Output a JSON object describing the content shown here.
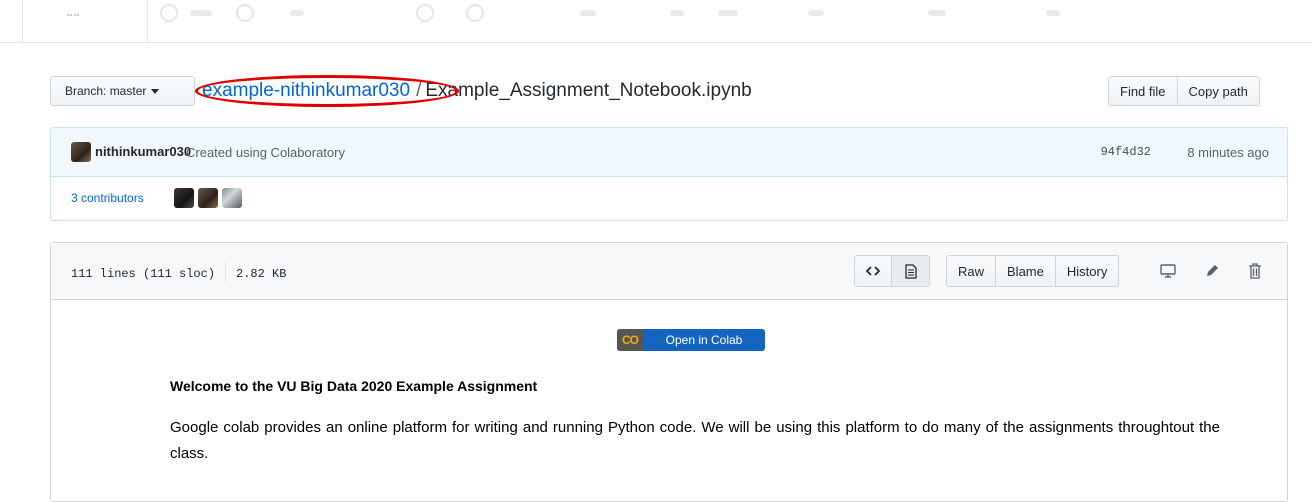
{
  "branch": {
    "label": "Branch: master"
  },
  "breadcrumb": {
    "repo": "example-nithinkumar030",
    "separator": "/",
    "file": "Example_Assignment_Notebook.ipynb"
  },
  "file_actions": {
    "find_file": "Find file",
    "copy_path": "Copy path"
  },
  "commit": {
    "author": "nithinkumar030",
    "message": "Created using Colaboratory",
    "sha": "94f4d32",
    "time": "8 minutes ago",
    "contributors": "3 contributors"
  },
  "file": {
    "lines": "111 lines (111 sloc)",
    "size": "2.82 KB",
    "buttons": {
      "raw": "Raw",
      "blame": "Blame",
      "history": "History"
    }
  },
  "notebook": {
    "badge_logo": "CO",
    "badge_text": "Open in Colab",
    "heading": "Welcome to the VU Big Data 2020 Example Assignment",
    "paragraph": "Google colab provides an online platform for writing and running Python code. We will be using this platform to do many of the assignments throughtout the class."
  },
  "colors": {
    "link": "#0366d6",
    "highlight_ellipse": "#e00000",
    "commit_bg": "#f1f8ff"
  },
  "icons": [
    "code-icon",
    "file-text-icon",
    "desktop-icon",
    "pencil-icon",
    "trash-icon",
    "caret-down-icon"
  ]
}
